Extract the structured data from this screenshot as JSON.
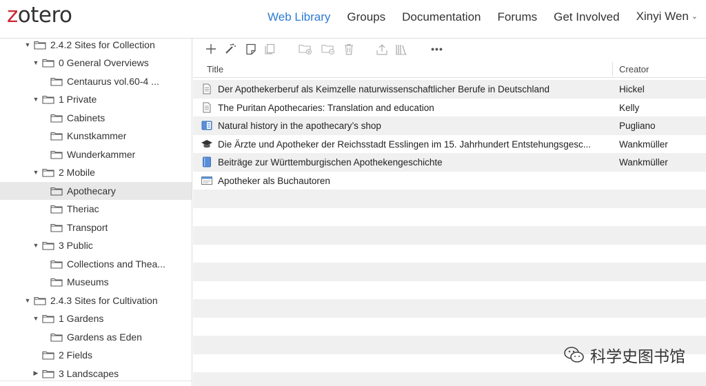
{
  "header": {
    "logo": {
      "z": "z",
      "rest": "otero"
    },
    "nav": [
      {
        "label": "Web Library",
        "active": true
      },
      {
        "label": "Groups"
      },
      {
        "label": "Documentation"
      },
      {
        "label": "Forums"
      },
      {
        "label": "Get Involved"
      },
      {
        "label": "Xinyi Wen",
        "has_dropdown": true
      }
    ]
  },
  "sidebar": {
    "items": [
      {
        "label": "2.4.2 Sites for Collection",
        "level": 1,
        "twisty": "open"
      },
      {
        "label": "0 General Overviews",
        "level": 2,
        "twisty": "open"
      },
      {
        "label": "Centaurus vol.60-4 ...",
        "level": 3,
        "twisty": "none"
      },
      {
        "label": "1 Private",
        "level": 2,
        "twisty": "open"
      },
      {
        "label": "Cabinets",
        "level": 3,
        "twisty": "none"
      },
      {
        "label": "Kunstkammer",
        "level": 3,
        "twisty": "none"
      },
      {
        "label": "Wunderkammer",
        "level": 3,
        "twisty": "none"
      },
      {
        "label": "2 Mobile",
        "level": 2,
        "twisty": "open"
      },
      {
        "label": "Apothecary",
        "level": 3,
        "twisty": "none",
        "selected": true
      },
      {
        "label": "Theriac",
        "level": 3,
        "twisty": "none"
      },
      {
        "label": "Transport",
        "level": 3,
        "twisty": "none"
      },
      {
        "label": "3 Public",
        "level": 2,
        "twisty": "open"
      },
      {
        "label": "Collections and Thea...",
        "level": 3,
        "twisty": "none"
      },
      {
        "label": "Museums",
        "level": 3,
        "twisty": "none"
      },
      {
        "label": "2.4.3 Sites for Cultivation",
        "level": 1,
        "twisty": "open"
      },
      {
        "label": "1 Gardens",
        "level": 2,
        "twisty": "open"
      },
      {
        "label": "Gardens as Eden",
        "level": 3,
        "twisty": "none"
      },
      {
        "label": "2 Fields",
        "level": 2,
        "twisty": "none"
      },
      {
        "label": "3 Landscapes",
        "level": 2,
        "twisty": "closed"
      }
    ]
  },
  "toolbar": {
    "buttons": [
      {
        "name": "new-item-plus-icon",
        "glyph": "+"
      },
      {
        "name": "add-by-identifier-wand-icon",
        "glyph": "wand"
      },
      {
        "name": "new-note-icon",
        "glyph": "note"
      },
      {
        "name": "duplicate-item-icon",
        "glyph": "dup",
        "disabled": true
      },
      {
        "name": "add-to-collection-icon",
        "glyph": "folderplus",
        "disabled": true
      },
      {
        "name": "remove-from-collection-icon",
        "glyph": "folderminus",
        "disabled": true
      },
      {
        "name": "trash-icon",
        "glyph": "trash",
        "disabled": true
      },
      {
        "name": "export-icon",
        "glyph": "export",
        "disabled": true
      },
      {
        "name": "library-bibliography-icon",
        "glyph": "books",
        "disabled": true
      },
      {
        "name": "more-options-icon",
        "glyph": "•••"
      }
    ]
  },
  "columns": {
    "title": "Title",
    "creator": "Creator"
  },
  "items": [
    {
      "type": "document",
      "title": "Der Apothekerberuf als Keimzelle naturwissenschaftlicher Berufe in Deutschland",
      "creator": "Hickel"
    },
    {
      "type": "document",
      "title": "The Puritan Apothecaries: Translation and education",
      "creator": "Kelly"
    },
    {
      "type": "book-section",
      "title": "Natural history in the apothecary’s shop",
      "creator": "Pugliano"
    },
    {
      "type": "thesis",
      "title": "Die Ärzte und Apotheker der Reichsstadt Esslingen im 15. Jahrhundert Entstehungsgesc...",
      "creator": "Wankmüller"
    },
    {
      "type": "book",
      "title": "Beiträge zur Württemburgischen Apothekengeschichte",
      "creator": "Wankmüller"
    },
    {
      "type": "webpage",
      "title": "Apotheker als Buchautoren",
      "creator": ""
    }
  ],
  "empty_rows": 11,
  "watermark": {
    "text": "科学史图书馆"
  },
  "colors": {
    "accent": "#2e7bd1",
    "brand": "#cc2936",
    "selected": "#e8e8e8",
    "stripe": "#f0f0f0"
  }
}
